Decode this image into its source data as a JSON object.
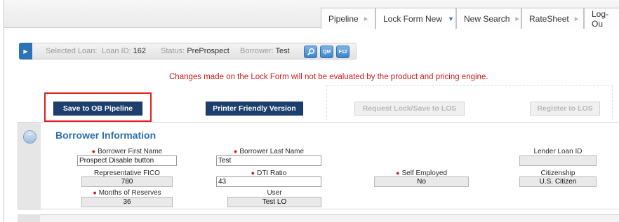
{
  "tabs": [
    {
      "label": "Pipeline",
      "active": false
    },
    {
      "label": "Lock Form New",
      "active": true
    },
    {
      "label": "New Search",
      "active": false
    },
    {
      "label": "RateSheet",
      "active": false
    },
    {
      "label": "Log-Ou",
      "active": false
    }
  ],
  "loan_bar": {
    "selected_loan_label": "Selected Loan:",
    "loan_id_label": "Loan ID:",
    "loan_id_value": "162",
    "status_label": "Status:",
    "status_value": "PreProspect",
    "borrower_label": "Borrower:",
    "borrower_value": "Test",
    "icons": [
      "search-icon",
      "qm-icon",
      "f12-icon"
    ],
    "icon_text": {
      "qm": "QM",
      "f12": "F12"
    }
  },
  "warning": "Changes made on the Lock Form will not be evaluated by the product and pricing engine.",
  "actions": {
    "save_to_pipeline": "Save to OB Pipeline",
    "printer_friendly": "Printer Friendly Version",
    "request_lock": "Request Lock/Save to LOS",
    "register": "Register to LOS"
  },
  "borrower_section": {
    "title": "Borrower Information",
    "first_name_label": "Borrower First Name",
    "first_name_value": "Prospect Disable button",
    "last_name_label": "Borrower Last Name",
    "last_name_value": "Test",
    "lender_loan_id_label": "Lender Loan ID",
    "lender_loan_id_value": "",
    "fico_label": "Representative FICO",
    "fico_value": "780",
    "dti_label": "DTI Ratio",
    "dti_value": "43",
    "self_employed_label": "Self Employed",
    "self_employed_value": "No",
    "citizenship_label": "Citizenship",
    "citizenship_value": "U.S. Citizen",
    "reserves_label": "Months of Reserves",
    "reserves_value": "36",
    "user_label": "User",
    "user_value": "Test LO"
  },
  "colors": {
    "accent": "#2a6fb0",
    "primary_button": "#1d3f6e",
    "warning": "#d11b1b",
    "highlight_box": "#e02020"
  }
}
